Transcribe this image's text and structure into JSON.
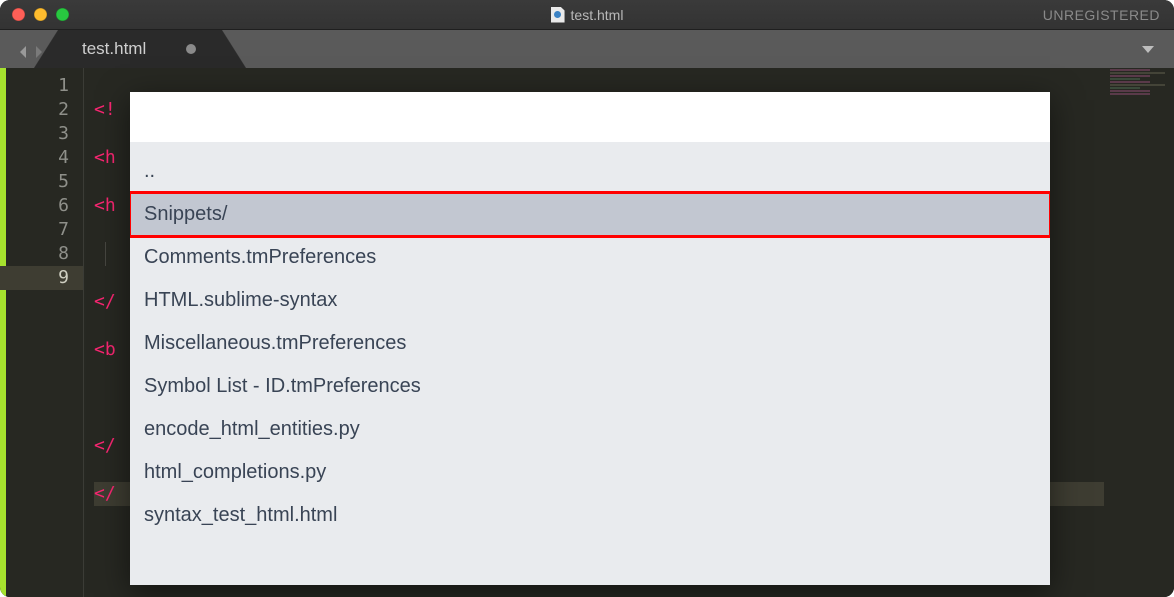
{
  "window": {
    "title": "test.html",
    "registration_label": "UNREGISTERED"
  },
  "tabs": [
    {
      "label": "test.html",
      "dirty": true
    }
  ],
  "editor": {
    "line_numbers": [
      "1",
      "2",
      "3",
      "4",
      "5",
      "6",
      "7",
      "8",
      "9"
    ],
    "active_line_index": 8,
    "lines": [
      {
        "visible": "<!"
      },
      {
        "visible": "<h"
      },
      {
        "visible": "<h"
      },
      {
        "visible": "",
        "indent": true
      },
      {
        "visible": "</"
      },
      {
        "visible": "<b"
      },
      {
        "visible": ""
      },
      {
        "visible": "</"
      },
      {
        "visible": "</"
      }
    ]
  },
  "overlay": {
    "items": [
      {
        "label": ".."
      },
      {
        "label": "Snippets/",
        "highlighted": true
      },
      {
        "label": "Comments.tmPreferences"
      },
      {
        "label": "HTML.sublime-syntax"
      },
      {
        "label": "Miscellaneous.tmPreferences"
      },
      {
        "label": "Symbol List - ID.tmPreferences"
      },
      {
        "label": "encode_html_entities.py"
      },
      {
        "label": "html_completions.py"
      },
      {
        "label": "syntax_test_html.html"
      }
    ]
  }
}
